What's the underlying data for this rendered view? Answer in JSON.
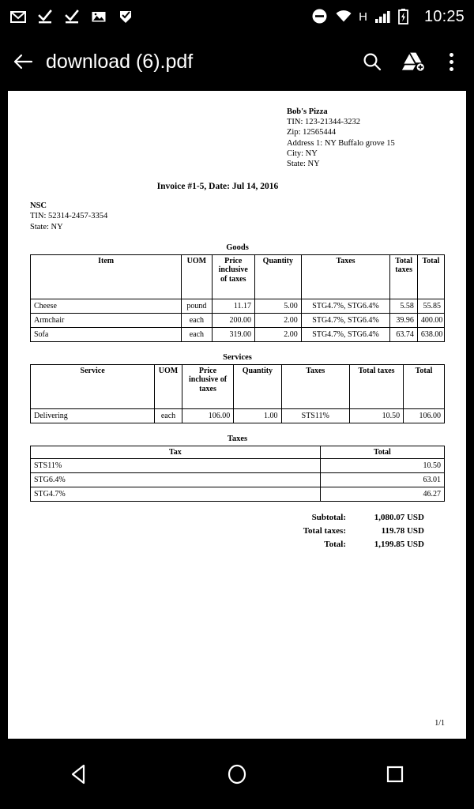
{
  "status_bar": {
    "left_icons": [
      {
        "name": "gmail-icon",
        "label": "Gmail"
      },
      {
        "name": "download-complete-icon",
        "label": "Download complete"
      },
      {
        "name": "download-complete-icon-2",
        "label": "Download complete"
      },
      {
        "name": "image-icon",
        "label": "Screenshot"
      },
      {
        "name": "checkmark-flag-icon",
        "label": "Task"
      }
    ],
    "right_icons": [
      {
        "name": "do-not-disturb-icon",
        "label": "Do not disturb"
      },
      {
        "name": "wifi-icon",
        "label": "Wi-Fi"
      },
      {
        "name": "network-type-label",
        "label": "H"
      },
      {
        "name": "signal-bars-icon",
        "label": "Signal"
      },
      {
        "name": "battery-charging-icon",
        "label": "Battery charging"
      }
    ],
    "network_type": "H",
    "clock": "10:25"
  },
  "app_bar": {
    "back_label": "Back",
    "title": "download (6).pdf",
    "actions": [
      {
        "name": "search-icon",
        "label": "Search"
      },
      {
        "name": "add-to-drive-icon",
        "label": "Save to Drive"
      },
      {
        "name": "overflow-menu-icon",
        "label": "More options"
      }
    ]
  },
  "document": {
    "vendor": {
      "name": "Bob's Pizza",
      "tin": "TIN: 123-21344-3232",
      "zip": "Zip: 12565444",
      "address": "Address 1: NY Buffalo grove 15",
      "city": "City: NY",
      "state": "State: NY"
    },
    "invoice_line": "Invoice #1-5, Date:  Jul 14, 2016",
    "buyer": {
      "name": "NSC",
      "tin": "TIN: 52314-2457-3354",
      "state": "State: NY"
    },
    "goods": {
      "section_title": "Goods",
      "headers": [
        "Item",
        "UOM",
        "Price inclusive of taxes",
        "Quantity",
        "Taxes",
        "Total taxes",
        "Total"
      ],
      "rows": [
        {
          "item": "Cheese",
          "uom": "pound",
          "price": "11.17",
          "quantity": "5.00",
          "taxes": "STG4.7%, STG6.4%",
          "total_taxes": "5.58",
          "total": "55.85"
        },
        {
          "item": "Armchair",
          "uom": "each",
          "price": "200.00",
          "quantity": "2.00",
          "taxes": "STG4.7%, STG6.4%",
          "total_taxes": "39.96",
          "total": "400.00"
        },
        {
          "item": "Sofa",
          "uom": "each",
          "price": "319.00",
          "quantity": "2.00",
          "taxes": "STG4.7%, STG6.4%",
          "total_taxes": "63.74",
          "total": "638.00"
        }
      ]
    },
    "services": {
      "section_title": "Services",
      "headers": [
        "Service",
        "UOM",
        "Price inclusive of taxes",
        "Quantity",
        "Taxes",
        "Total taxes",
        "Total"
      ],
      "rows": [
        {
          "service": "Delivering",
          "uom": "each",
          "price": "106.00",
          "quantity": "1.00",
          "taxes": "STS11%",
          "total_taxes": "10.50",
          "total": "106.00"
        }
      ]
    },
    "taxes": {
      "section_title": "Taxes",
      "headers": [
        "Tax",
        "Total"
      ],
      "rows": [
        {
          "tax": "STS11%",
          "total": "10.50"
        },
        {
          "tax": "STG6.4%",
          "total": "63.01"
        },
        {
          "tax": "STG4.7%",
          "total": "46.27"
        }
      ]
    },
    "totals": [
      {
        "label": "Subtotal:",
        "value": "1,080.07 USD"
      },
      {
        "label": "Total taxes:",
        "value": "119.78 USD"
      },
      {
        "label": "Total:",
        "value": "1,199.85 USD"
      }
    ],
    "page_number": "1/1"
  },
  "nav_bar": {
    "buttons": [
      {
        "name": "back-nav-button",
        "label": "Back"
      },
      {
        "name": "home-nav-button",
        "label": "Home"
      },
      {
        "name": "recents-nav-button",
        "label": "Recent apps"
      }
    ]
  },
  "colors": {
    "system_background": "#000000",
    "page_background": "#ffffff",
    "text_on_dark": "#ffffff",
    "document_text": "#000000"
  }
}
